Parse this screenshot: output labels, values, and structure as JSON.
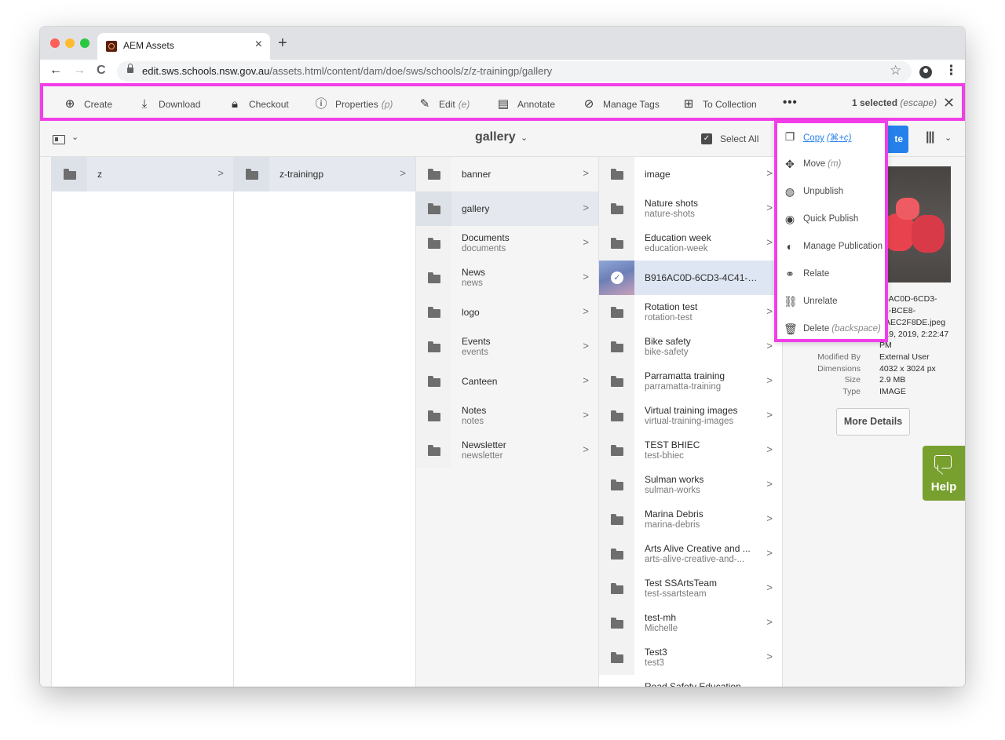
{
  "browser": {
    "tab_title": "AEM Assets",
    "tab_close": "×",
    "new_tab": "+",
    "url_host": "edit.sws.schools.nsw.gov.au",
    "url_path": "/assets.html/content/dam/doe/sws/schools/z/z-trainingp/gallery",
    "back_icon": "←",
    "forward_icon": "→",
    "reload_icon": "C",
    "star_icon": "☆",
    "menu_icon": "⋮"
  },
  "actionbar": {
    "create": "Create",
    "download": "Download",
    "checkout": "Checkout",
    "properties": "Properties",
    "properties_key": "(p)",
    "edit": "Edit",
    "edit_key": "(e)",
    "annotate": "Annotate",
    "manage_tags": "Manage Tags",
    "to_collection": "To Collection",
    "more": "•••",
    "selected": "1 selected",
    "escape_key": "(escape)",
    "close": "✕"
  },
  "toolbar": {
    "breadcrumb": "gallery",
    "select_all": "Select All",
    "create_partial": "te"
  },
  "columns": {
    "col1": [
      {
        "title": "z"
      }
    ],
    "col2": [
      {
        "title": "z-trainingp"
      }
    ],
    "col3": [
      {
        "title": "banner",
        "sub": ""
      },
      {
        "title": "gallery",
        "sub": ""
      },
      {
        "title": "Documents",
        "sub": "documents"
      },
      {
        "title": "News",
        "sub": "news"
      },
      {
        "title": "logo",
        "sub": ""
      },
      {
        "title": "Events",
        "sub": "events"
      },
      {
        "title": "Canteen",
        "sub": ""
      },
      {
        "title": "Notes",
        "sub": "notes"
      },
      {
        "title": "Newsletter",
        "sub": "newsletter"
      }
    ],
    "col4": [
      {
        "title": "image",
        "sub": ""
      },
      {
        "title": "Nature shots",
        "sub": "nature-shots"
      },
      {
        "title": "Education week",
        "sub": "education-week"
      },
      {
        "title": "B916AC0D-6CD3-4C41-BCE8-0...",
        "sub": ""
      },
      {
        "title": "Rotation test",
        "sub": "rotation-test"
      },
      {
        "title": "Bike safety",
        "sub": "bike-safety"
      },
      {
        "title": "Parramatta training",
        "sub": "parramatta-training"
      },
      {
        "title": "Virtual training images",
        "sub": "virtual-training-images"
      },
      {
        "title": "TEST BHIEC",
        "sub": "test-bhiec"
      },
      {
        "title": "Sulman works",
        "sub": "sulman-works"
      },
      {
        "title": "Marina Debris",
        "sub": "marina-debris"
      },
      {
        "title": "Arts Alive Creative and ...",
        "sub": "arts-alive-creative-and-..."
      },
      {
        "title": "Test SSArtsTeam",
        "sub": "test-ssartsteam"
      },
      {
        "title": "test-mh",
        "sub": "Michelle"
      },
      {
        "title": "Test3",
        "sub": "test3"
      }
    ],
    "col4_cutoff": "Road Safety Education"
  },
  "preview": {
    "name_lines": [
      "16AC0D-6CD3-",
      "41-BCE8-",
      "EAEC2F8DE.jpeg"
    ],
    "date_line": "r 19, 2019, 2:22:47",
    "date_suffix": "PM",
    "modified_by_label": "Modified By",
    "modified_by": "External User",
    "dimensions_label": "Dimensions",
    "dimensions": "4032 x 3024 px",
    "size_label": "Size",
    "size": "2.9 MB",
    "type_label": "Type",
    "type": "IMAGE",
    "more_details": "More Details"
  },
  "menu": [
    {
      "label": "Copy",
      "key": "(⌘+c)",
      "icon": "copy-icon"
    },
    {
      "label": "Move",
      "key": "(m)",
      "icon": "move-icon"
    },
    {
      "label": "Unpublish",
      "key": "",
      "icon": "unpublish-icon"
    },
    {
      "label": "Quick Publish",
      "key": "",
      "icon": "quick-publish-icon"
    },
    {
      "label": "Manage Publication",
      "key": "",
      "icon": "manage-publication-icon"
    },
    {
      "label": "Relate",
      "key": "",
      "icon": "link-icon"
    },
    {
      "label": "Unrelate",
      "key": "",
      "icon": "unlink-icon"
    },
    {
      "label": "Delete",
      "key": "(backspace)",
      "icon": "trash-icon"
    }
  ],
  "help": {
    "label": "Help"
  },
  "colors": {
    "highlight": "#f23ee8",
    "accent": "#2680eb",
    "help_green": "#78a02e"
  }
}
